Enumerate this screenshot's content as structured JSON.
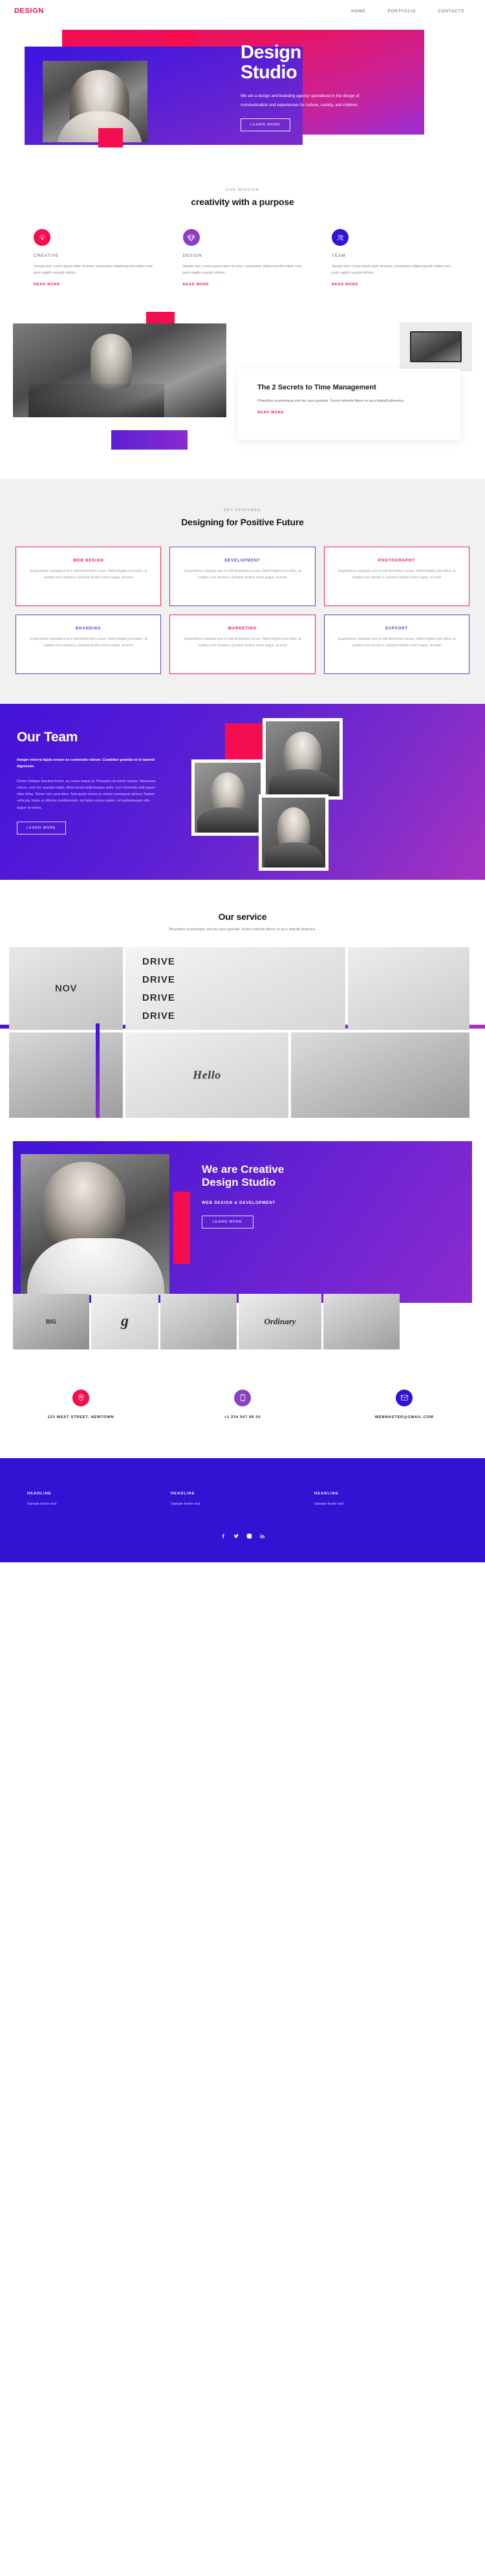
{
  "header": {
    "logo": "DESIGN",
    "nav": [
      {
        "label": "HOME"
      },
      {
        "label": "PORTFOLIO"
      },
      {
        "label": "CONTACTS"
      }
    ]
  },
  "hero": {
    "title_line1": "Design",
    "title_line2": "Studio",
    "description": "We are a design and branding agency specialised in the design of communication and experiences for culture, society, and children.",
    "button": "LEARN MORE",
    "colors": {
      "pink": "#f40d4f",
      "purple": "#4312d9"
    }
  },
  "mission": {
    "eyebrow": "OUR MISSION",
    "title": "creativity with a purpose",
    "cards": [
      {
        "icon": "lightbulb-icon",
        "color": "#f40d4f",
        "title": "CREATIVE",
        "body": "Sample text. Lorem ipsum dolor sit amet, consectetur adipiscing elit nullam nunc justo sagittis suscipit ultrices.",
        "link": "READ MORE"
      },
      {
        "icon": "diamond-icon",
        "color": "#8b3fc4",
        "title": "DESIGN",
        "body": "Sample text. Lorem ipsum dolor sit amet, consectetur adipiscing elit nullam nunc justo sagittis suscipit ultrices.",
        "link": "READ MORE"
      },
      {
        "icon": "users-icon",
        "color": "#3412d4",
        "title": "TEAM",
        "body": "Sample text. Lorem ipsum dolor sit amet, consectetur adipiscing elit nullam nunc justo sagittis suscipit ultrices.",
        "link": "READ MORE"
      }
    ]
  },
  "secrets": {
    "title": "The 2 Secrets to Time Management",
    "body": "Phasellus scelerisque sed leo quis gravida. Fusce lobortis libero ut arcu blandit pharetra.",
    "link": "READ MORE"
  },
  "features": {
    "eyebrow": "KEY FEATURES",
    "title": "Designing for Positive Future",
    "body": "Suspendisse vulputate eros in velit fermentum cursus. Nulla fringilla justo tellus, at sodales eros laoreet a. Quisque facilisis lorem augue, sit amet",
    "cards": [
      {
        "title": "WEB DESIGN",
        "accent": "red"
      },
      {
        "title": "DEVELOPMENT",
        "accent": "purple"
      },
      {
        "title": "PHOTOGRAPHY",
        "accent": "red"
      },
      {
        "title": "BRANDING",
        "accent": "purple"
      },
      {
        "title": "MARKETING",
        "accent": "red"
      },
      {
        "title": "SUPPORT",
        "accent": "purple"
      }
    ]
  },
  "team": {
    "title": "Our Team",
    "lead": "Integer viverra ligula ornare ex commodo rutrum. Curabitur gravida ex in laoreet dignissim.",
    "body": "Donec tristique faucibus lorem, eu varius neque at. Phasellus at rutrum mauris. Maecenas rutrum, velit nec suscipit mattis, tellus lorem pellentesque dolor, non commodo velit ipsum vitae tellus. Donec non urna diam. Sed auctor lectus eu metus consequat ultrices. Nullam vehicula, turpis at ultrices condimentum, est tellus varius sapien, vel pellentesque odio augue at metus.",
    "button": "LEARN MORE"
  },
  "service": {
    "title": "Our service",
    "subtitle": "Phasellus scelerisque sed leo quis gravida. Fusce lobortis libero ut arcu blandit pharetra.",
    "tiles": [
      {
        "label": "NOV",
        "name": "poster-tile"
      },
      {
        "label": "DRIVE",
        "name": "drive-tile"
      },
      {
        "label": "",
        "name": "stationery-tile"
      },
      {
        "label": "",
        "name": "bottle-tile"
      },
      {
        "label": "Hello",
        "name": "hello-tile"
      },
      {
        "label": "",
        "name": "brochure-tile"
      }
    ]
  },
  "creative": {
    "title_line1": "We are Creative",
    "title_line2": "Design Studio",
    "subtitle": "WEB DESIGN & DEVELOPMENT",
    "button": "LEARN MORE",
    "strip": [
      {
        "label": "BIG",
        "name": "typography-tile"
      },
      {
        "label": "g",
        "name": "letter-g-tile"
      },
      {
        "label": "",
        "name": "pens-tile"
      },
      {
        "label": "Ordinary",
        "name": "ordinary-tile"
      },
      {
        "label": "",
        "name": "mockup-tile"
      }
    ]
  },
  "contact": {
    "items": [
      {
        "icon": "location-pin-icon",
        "color": "#f40d4f",
        "text": "123 WEST STREET, NEWTOWN"
      },
      {
        "icon": "phone-icon",
        "color": "#8b3fc4",
        "text": "+1 234 567 89 00"
      },
      {
        "icon": "envelope-icon",
        "color": "#3412d4",
        "text": "WEBMASTER@GMAIL.COM"
      }
    ]
  },
  "footer": {
    "columns": [
      {
        "headline": "HEADLINE",
        "text": "Sample footer text"
      },
      {
        "headline": "HEADLINE",
        "text": "Sample footer text"
      },
      {
        "headline": "HEADLINE",
        "text": "Sample footer text"
      }
    ],
    "socials": [
      {
        "name": "facebook-icon"
      },
      {
        "name": "twitter-icon"
      },
      {
        "name": "instagram-icon"
      },
      {
        "name": "linkedin-icon"
      }
    ],
    "background": "#3412d4"
  }
}
